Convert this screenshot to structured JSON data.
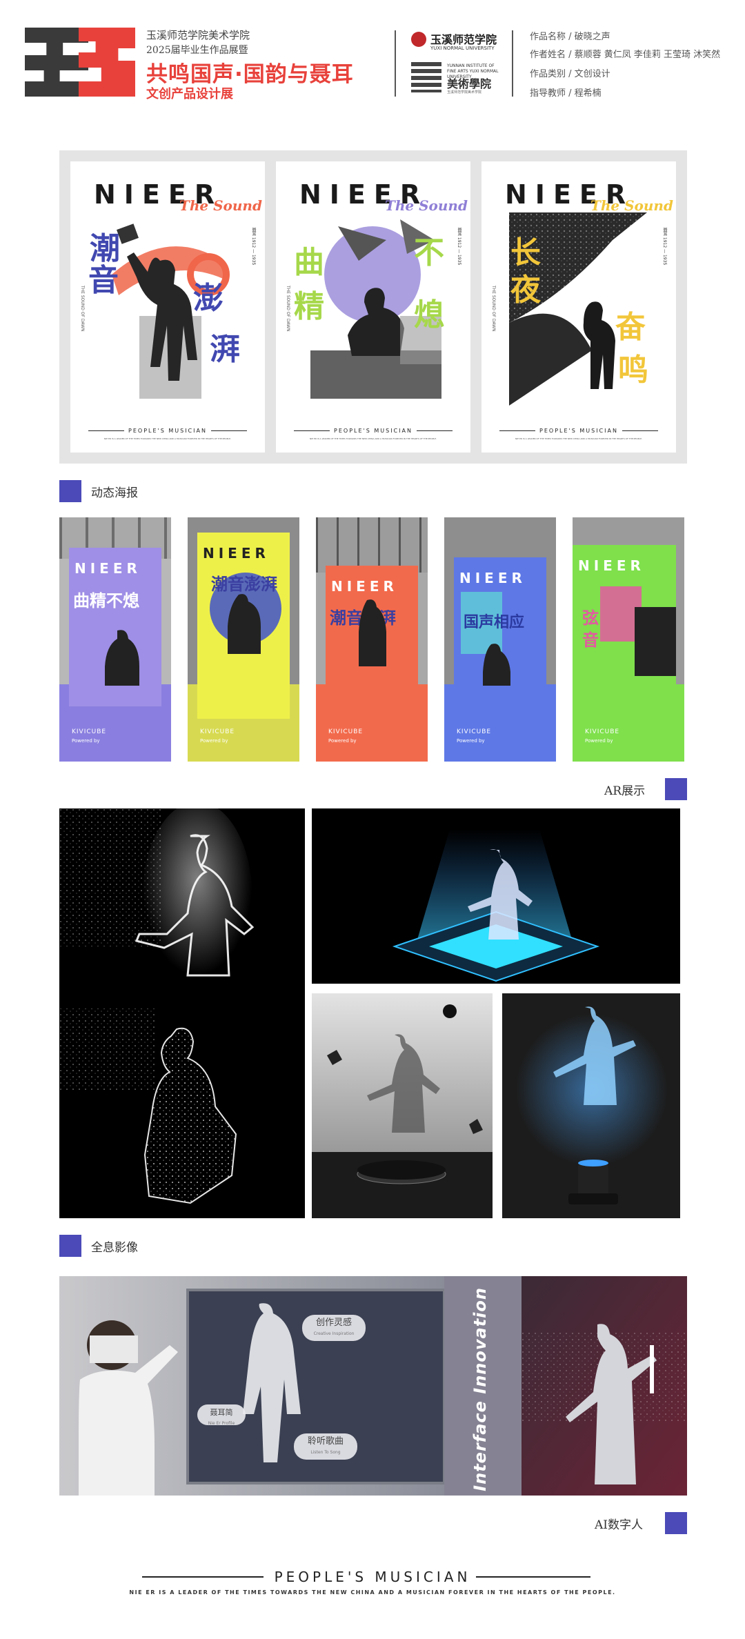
{
  "header": {
    "school_line1": "玉溪师范学院美术学院",
    "school_line2": "2025届毕业生作品展暨",
    "main_title": "共鸣国声·国韵与聂耳",
    "sub_title": "文创产品设计展",
    "university_name": "玉溪师范学院",
    "university_en": "YUXI NORMAL UNIVERSITY",
    "art_school_en": "YUNNAN INSTITUTE OF FINE ARTS YUXI NORMAL UNIVERSITY",
    "art_school_name": "美術學院",
    "art_school_sub": "玉溪师范学院美术学院",
    "info": [
      "作品名称 / 破晓之声",
      "作者姓名 / 蔡顺蓉 黄仁凤 李佳莉 王莹琦 沐笑然",
      "作品类别 / 文创设计",
      "指导教师 / 程希楠"
    ]
  },
  "posters": [
    {
      "title": "NIEER",
      "sound": "The Sound",
      "chars": [
        "潮",
        "音",
        "澎",
        "湃"
      ],
      "accent": "#f0664a",
      "char_color": "#4148b0",
      "footer": "PEOPLE'S MUSICIAN",
      "sub": "NIE ER IS A LEADER OF THE TIMES TOWARDS THE NEW CHINA AND A MUSICIAN FOREVER IN THE HEARTS OF THE PEOPLE.",
      "side": "THE SOUND OF DAWN",
      "rside": "聂耳 1912 — 1935"
    },
    {
      "title": "NIEER",
      "sound": "The Sound",
      "chars": [
        "曲",
        "精",
        "不",
        "熄"
      ],
      "accent": "#8f7fd6",
      "char_color": "#a6d84a",
      "footer": "PEOPLE'S MUSICIAN",
      "sub": "NIE ER IS A LEADER OF THE TIMES TOWARDS THE NEW CHINA AND A MUSICIAN FOREVER IN THE HEARTS OF THE PEOPLE.",
      "side": "THE SOUND OF DAWN",
      "rside": "聂耳 1912 — 1935"
    },
    {
      "title": "NIEER",
      "sound": "The Sound",
      "chars": [
        "长",
        "夜",
        "奋",
        "鸣"
      ],
      "accent": "#f2c63a",
      "char_color": "#f2c63a",
      "footer": "PEOPLE'S MUSICIAN",
      "sub": "NIE ER IS A LEADER OF THE TIMES TOWARDS THE NEW CHINA AND A MUSICIAN FOREVER IN THE HEARTS OF THE PEOPLE.",
      "side": "THE SOUND OF DAWN",
      "rside": "聂耳 1912 — 1935"
    }
  ],
  "sections": {
    "poster_label": "动态海报",
    "ar_label": "AR展示",
    "holo_label": "全息影像",
    "ai_label": "AI数字人"
  },
  "ar_cards": [
    {
      "title": "NIEER",
      "chars": "曲精不熄",
      "bg": "#9f8fe6",
      "brand": "KIVICUBE",
      "powered": "Powered by"
    },
    {
      "title": "NIEER",
      "chars": "潮音澎湃",
      "bg": "#eef04a",
      "brand": "KIVICUBE",
      "powered": "Powered by"
    },
    {
      "title": "NIEER",
      "chars": "潮音澎湃",
      "bg": "#f26a4c",
      "brand": "KIVICUBE",
      "powered": "Powered by"
    },
    {
      "title": "NIEER",
      "chars": "国声相应",
      "bg": "#5e78e6",
      "brand": "KIVICUBE",
      "powered": "Powered by"
    },
    {
      "title": "NIEER",
      "chars": "弦音",
      "bg": "#7fe04c",
      "brand": "KIVICUBE",
      "powered": "Powered by"
    }
  ],
  "interface": {
    "label": "Interface Innovation",
    "buttons": [
      {
        "cn": "创作灵感",
        "en": "Creative Inspiration"
      },
      {
        "cn": "聆听歌曲",
        "en": "Listen To Song"
      },
      {
        "cn": "聂耳简",
        "en": "Nie Er Profile"
      }
    ]
  },
  "footer": {
    "title": "PEOPLE'S MUSICIAN",
    "sub": "NIE ER IS A LEADER OF THE TIMES TOWARDS THE NEW CHINA AND A MUSICIAN FOREVER IN THE HEARTS OF THE PEOPLE."
  },
  "colors": {
    "accent": "#4b4ab8",
    "brand_red": "#e8413b"
  }
}
